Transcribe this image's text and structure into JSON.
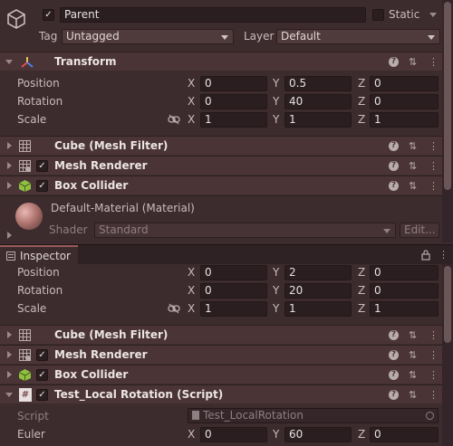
{
  "top": {
    "name": "Parent",
    "static_label": "Static",
    "tag_label": "Tag",
    "tag_value": "Untagged",
    "layer_label": "Layer",
    "layer_value": "Default"
  },
  "transform1": {
    "title": "Transform",
    "rows": [
      {
        "label": "Position",
        "x": "0",
        "y": "0.5",
        "z": "0"
      },
      {
        "label": "Rotation",
        "x": "0",
        "y": "40",
        "z": "0"
      },
      {
        "label": "Scale",
        "x": "1",
        "y": "1",
        "z": "1"
      }
    ]
  },
  "components1": [
    {
      "title": "Cube (Mesh Filter)"
    },
    {
      "title": "Mesh Renderer"
    },
    {
      "title": "Box Collider"
    }
  ],
  "material": {
    "title": "Default-Material (Material)",
    "shader_label": "Shader",
    "shader_value": "Standard",
    "edit_label": "Edit..."
  },
  "inspector": {
    "tab_label": "Inspector",
    "rows": [
      {
        "label": "Position",
        "x": "0",
        "y": "2",
        "z": "0"
      },
      {
        "label": "Rotation",
        "x": "0",
        "y": "20",
        "z": "0"
      },
      {
        "label": "Scale",
        "x": "1",
        "y": "1",
        "z": "1"
      }
    ],
    "components": [
      {
        "title": "Cube (Mesh Filter)"
      },
      {
        "title": "Mesh Renderer"
      },
      {
        "title": "Box Collider"
      },
      {
        "title": "Test_Local Rotation (Script)"
      }
    ],
    "script_label": "Script",
    "script_value": "Test_LocalRotation",
    "euler_label": "Euler",
    "euler": {
      "x": "0",
      "y": "60",
      "z": "0"
    }
  },
  "axis": {
    "x": "X",
    "y": "Y",
    "z": "Z"
  },
  "icons": {
    "help": "?",
    "presets": "⇅",
    "more": "⋮"
  }
}
